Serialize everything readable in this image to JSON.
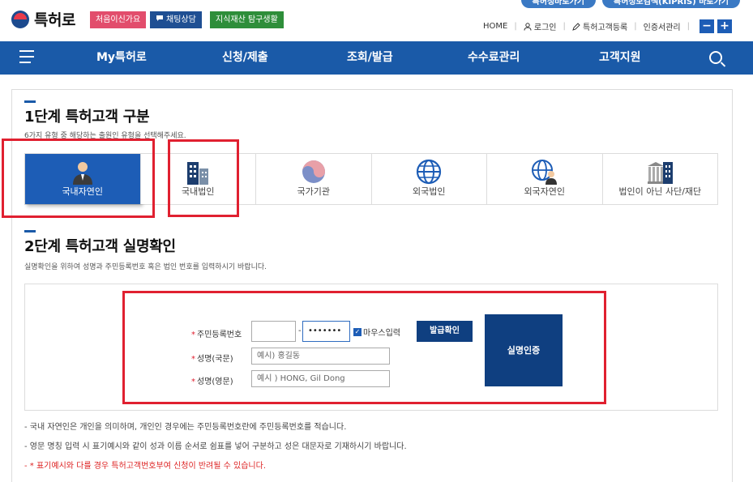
{
  "header": {
    "top_links": [
      "특허청바로가기",
      "특허정보검색(KIPRIS) 바로가기"
    ],
    "logo_text": "특허로",
    "tags": {
      "first_visit": "처음이신가요",
      "chat": "채팅상담",
      "ip_life": "지식재산 탐구생활"
    },
    "util": {
      "home": "HOME",
      "login": "로그인",
      "register": "특허고객등록",
      "cert": "인증서관리",
      "minus": "−",
      "plus": "+"
    }
  },
  "nav": {
    "items": [
      "My특허로",
      "신청/제출",
      "조회/발급",
      "수수료관리",
      "고객지원"
    ]
  },
  "step1": {
    "title": "1단계 특허고객 구분",
    "desc": "6가지 유형 중 해당하는 출원인 유형을 선택해주세요.",
    "types": [
      {
        "label": "국내자연인",
        "icon": "person-icon",
        "active": true
      },
      {
        "label": "국내법인",
        "icon": "building-icon",
        "active": false
      },
      {
        "label": "국가기관",
        "icon": "taegeuk-icon",
        "active": false
      },
      {
        "label": "외국법인",
        "icon": "globe-icon",
        "active": false
      },
      {
        "label": "외국자연인",
        "icon": "globe-person-icon",
        "active": false
      },
      {
        "label": "법인이 아닌 사단/재단",
        "icon": "institution-icon",
        "active": false
      }
    ]
  },
  "step2": {
    "title": "2단계 특허고객 실명확인",
    "desc": "실명확인을 위하여 성명과 주민등록번호 혹은 법인 번호를 입력하시기 바랍니다.",
    "form": {
      "rrn_label": "주민등록번호",
      "rrn_front": "",
      "rrn_sep": "-",
      "rrn_back": "•••••••",
      "mouse_input_label": "마우스입력",
      "issue_button": "발급확인",
      "name_kr_label": "성명(국문)",
      "name_kr_placeholder": "예시) 홍길동",
      "name_en_label": "성명(영문)",
      "name_en_placeholder": "예시 ) HONG, Gil Dong",
      "verify_button": "실명인증"
    }
  },
  "notes": [
    "- 국내 자연인은 개인을 의미하며, 개인인 경우에는 주민등록번호란에 주민등록번호를 적습니다.",
    "- 영문 명칭 입력 시 표기예시와 같이 성과 이름 순서로 쉼표를 넣어 구분하고 성은 대문자로 기재하시기 바랍니다.",
    "- * 표기예시와 다를 경우 특허고객번호부여 신청이 반려될 수 있습니다."
  ],
  "colors": {
    "primary": "#1a5aa8",
    "dark_button": "#0f3f80",
    "highlight": "#e02030"
  }
}
